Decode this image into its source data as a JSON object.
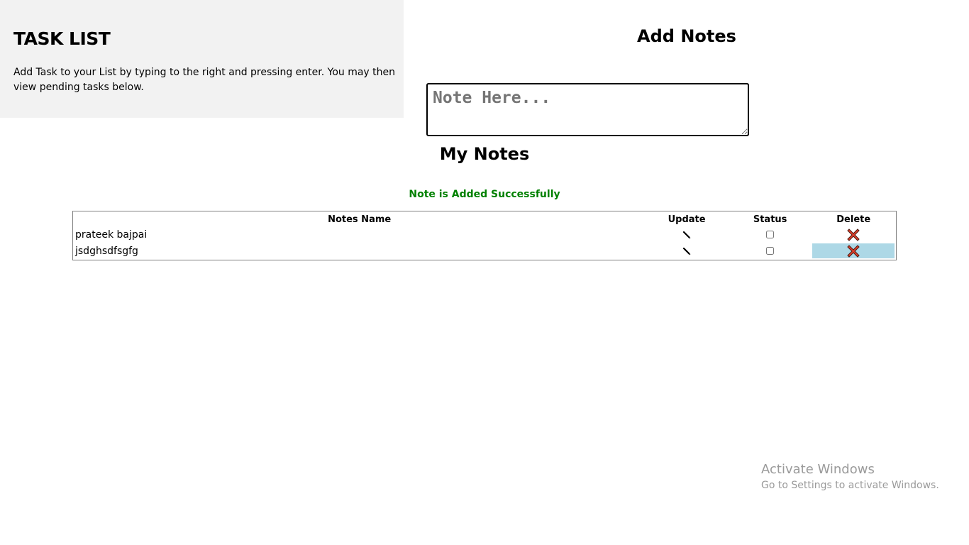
{
  "info": {
    "title": "TASK LIST",
    "description": "Add Task to your List by typing to the right and pressing enter. You may then view pending tasks below."
  },
  "add_notes": {
    "title": "Add Notes",
    "placeholder": "Note Here...",
    "value": ""
  },
  "my_notes": {
    "title": "My Notes",
    "status_message": "Note is Added Successfully",
    "status_color": "#008000",
    "columns": {
      "name": "Notes Name",
      "update": "Update",
      "status": "Status",
      "delete": "Delete"
    },
    "rows": [
      {
        "name": "prateek bajpai",
        "update_icon": "pencil-icon",
        "status_checked": false,
        "delete_icon": "delete-x-icon"
      },
      {
        "name": "jsdghsdfsgfg",
        "update_icon": "pencil-icon",
        "status_checked": false,
        "delete_icon": "delete-x-icon"
      }
    ],
    "highlight_color": "#add8e6"
  },
  "watermark": {
    "title": "Activate Windows",
    "subtitle": "Go to Settings to activate Windows."
  }
}
